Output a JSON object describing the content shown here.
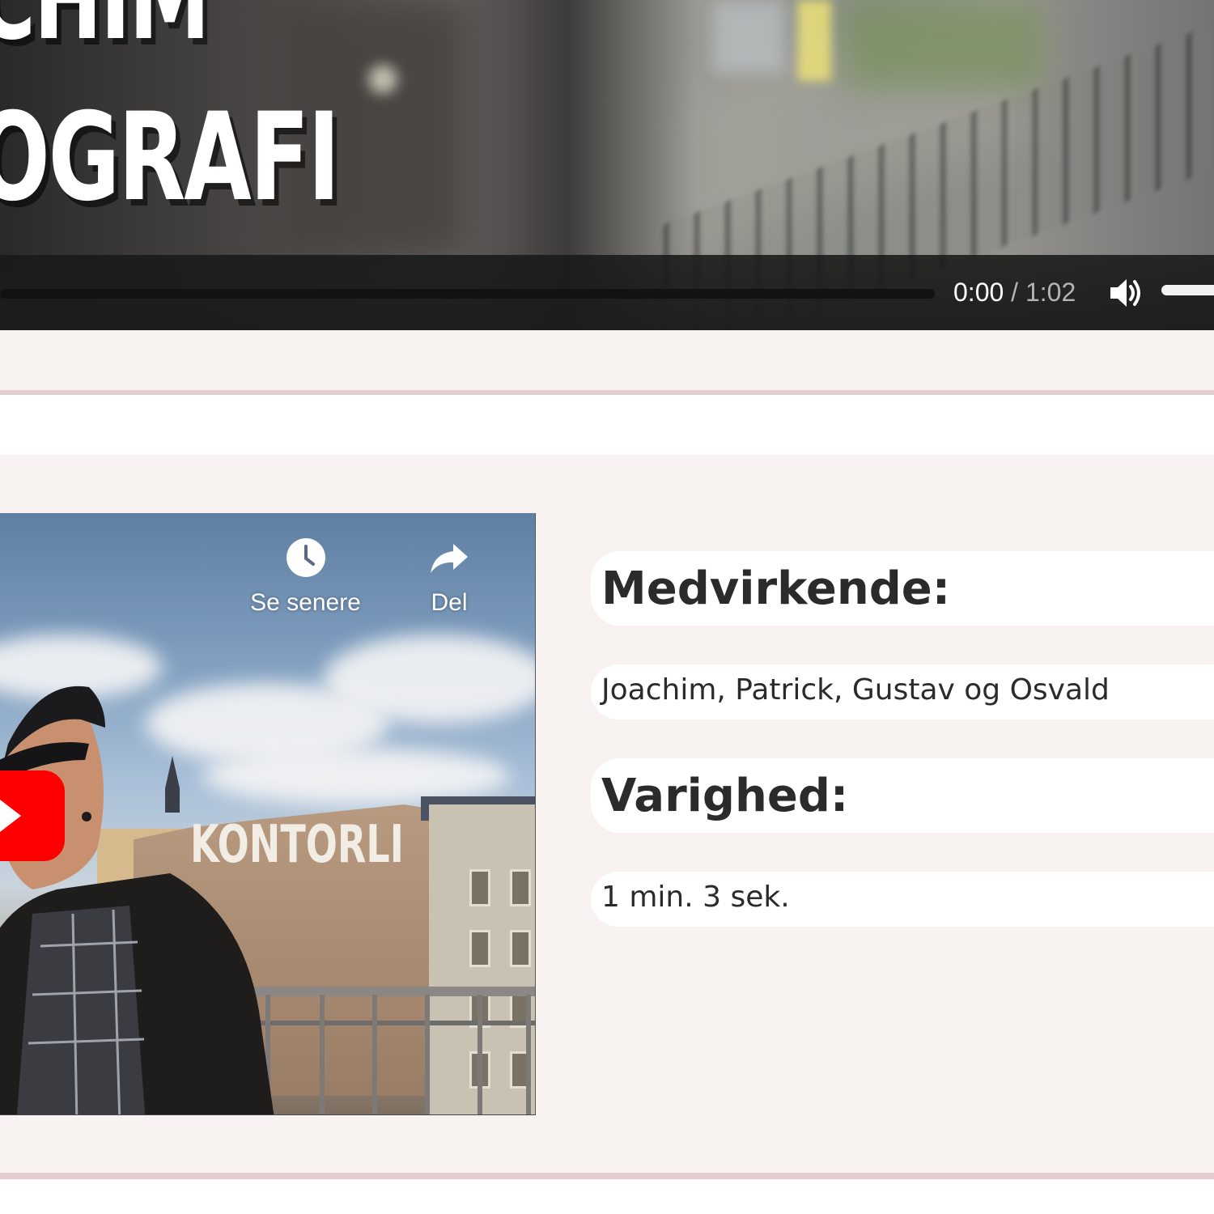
{
  "top_video": {
    "title_lines": [
      "CHIM",
      "OGRAFI"
    ],
    "current_time": "0:00",
    "separator": "/",
    "duration": "1:02",
    "progress_fraction": 0.0,
    "volume_icon": "volume-icon"
  },
  "youtube_embed": {
    "watch_later_label": "Se senere",
    "share_label": "Del",
    "watch_later_icon": "clock-icon",
    "share_icon": "share-arrow-icon",
    "play_icon": "youtube-play-icon",
    "wall_text": "KONTORLIV",
    "brand_color": "#ff0000"
  },
  "info": {
    "credits_heading": "Medvirkende:",
    "credits_value": "Joachim, Patrick, Gustav og Osvald",
    "duration_heading": "Varighed:",
    "duration_value": "1 min. 3 sek."
  },
  "colors": {
    "page_background": "#f8f3f0",
    "divider": "#e2ccd0",
    "pill_background": "#ffffff",
    "text": "#2b2b2b"
  }
}
